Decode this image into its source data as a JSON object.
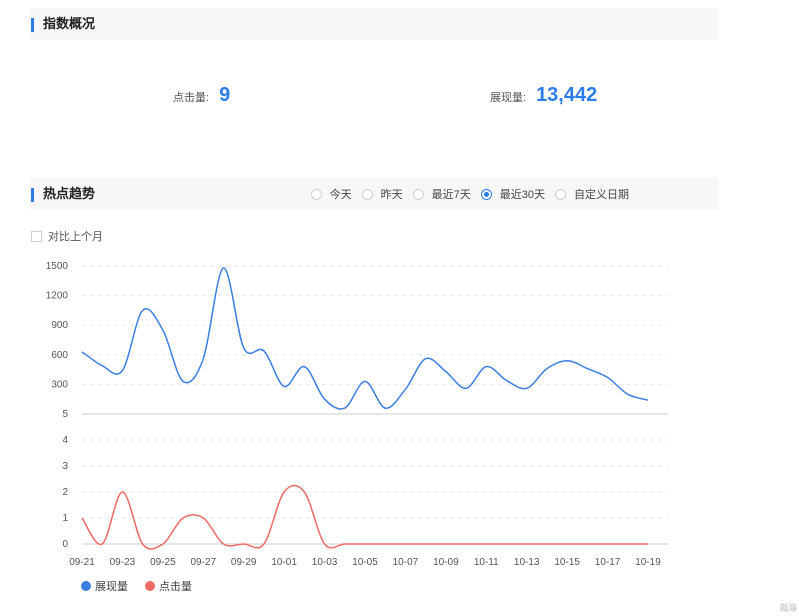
{
  "overview": {
    "title": "指数概况",
    "clicks_label": "点击量:",
    "clicks_value": "9",
    "impressions_label": "展现量:",
    "impressions_value": "13,442"
  },
  "trend": {
    "title": "热点趋势",
    "ranges": [
      {
        "label": "今天",
        "selected": false
      },
      {
        "label": "昨天",
        "selected": false
      },
      {
        "label": "最近7天",
        "selected": false
      },
      {
        "label": "最近30天",
        "selected": true
      },
      {
        "label": "自定义日期",
        "selected": false
      }
    ],
    "compare_label": "对比上个月"
  },
  "colors": {
    "accent": "#2b7de9",
    "impressions_series": "#3b7fe3",
    "clicks_series": "#ef6a64"
  },
  "corner_text": "瀚海",
  "chart_data": {
    "type": "line",
    "x": [
      "09-21",
      "09-22",
      "09-23",
      "09-24",
      "09-25",
      "09-26",
      "09-27",
      "09-28",
      "09-29",
      "09-30",
      "10-01",
      "10-02",
      "10-03",
      "10-04",
      "10-05",
      "10-06",
      "10-07",
      "10-08",
      "10-09",
      "10-10",
      "10-11",
      "10-12",
      "10-13",
      "10-14",
      "10-15",
      "10-16",
      "10-17",
      "10-18",
      "10-19"
    ],
    "x_tick_labels": [
      "09-21",
      "09-23",
      "09-25",
      "09-27",
      "09-29",
      "10-01",
      "10-03",
      "10-05",
      "10-07",
      "10-09",
      "10-11",
      "10-13",
      "10-15",
      "10-17",
      "10-19"
    ],
    "series": [
      {
        "name": "展现量",
        "axis": "upper",
        "values": [
          630,
          490,
          440,
          1050,
          850,
          330,
          560,
          1480,
          670,
          640,
          280,
          480,
          150,
          60,
          330,
          60,
          250,
          560,
          430,
          260,
          480,
          340,
          260,
          460,
          540,
          460,
          370,
          200,
          140
        ]
      },
      {
        "name": "点击量",
        "axis": "lower",
        "values": [
          1,
          0,
          2,
          0,
          0,
          1,
          1,
          0,
          0,
          0,
          2,
          2,
          0,
          0,
          0,
          0,
          0,
          0,
          0,
          0,
          0,
          0,
          0,
          0,
          0,
          0,
          0,
          0,
          0
        ]
      }
    ],
    "upper_axis": {
      "ticks": [
        "1500",
        "1200",
        "900",
        "600",
        "300"
      ],
      "range": [
        0,
        1500
      ]
    },
    "lower_axis": {
      "ticks": [
        "5",
        "4",
        "3",
        "2",
        "1",
        "0"
      ],
      "range": [
        0,
        5
      ]
    },
    "grid": true,
    "legend": "bottom-left"
  }
}
